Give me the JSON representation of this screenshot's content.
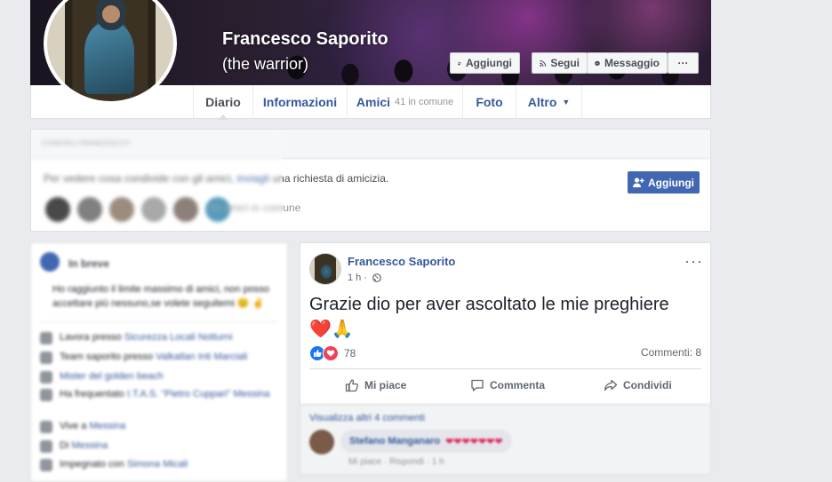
{
  "profile": {
    "name": "Francesco Saporito",
    "alias": "(the warrior)"
  },
  "cover_buttons": {
    "add_friend": "Aggiungi",
    "follow": "Segui",
    "message": "Messaggio",
    "more": "···"
  },
  "tabs": [
    {
      "label": "Diario"
    },
    {
      "label": "Informazioni"
    },
    {
      "label": "Amici",
      "sub": "41 in comune"
    },
    {
      "label": "Foto"
    },
    {
      "label": "Altro"
    }
  ],
  "know_box": {
    "heading": "CONOSCI FRANCESCO?",
    "text_before": "Per vedere cosa condivide con gli amici, ",
    "link": "inviagli",
    "text_after": " una richiesta di amicizia.",
    "mutual": "41 amici in comune",
    "add_button": "Aggiungi"
  },
  "intro": {
    "title": "In breve",
    "bio": "Ho raggiunto il limite massimo di amici, non posso accettare più nessuno,se volete seguitemi 😊 ✌",
    "rows": [
      {
        "prefix": "Lavora presso ",
        "link": "Sicurezza Locali Notturni"
      },
      {
        "prefix": "Team saporito presso ",
        "link": "Valkatlan Inti Marciali"
      },
      {
        "prefix": "",
        "link": "Mister del golden beach"
      },
      {
        "prefix": "Ha frequentato ",
        "link": "I.T.A.S. \"Pietro Cuppari\" Messina"
      },
      {
        "prefix": "Vive a ",
        "link": "Messina"
      },
      {
        "prefix": "Di ",
        "link": "Messina"
      },
      {
        "prefix": "Impegnato con ",
        "link": "Simona Micali"
      }
    ]
  },
  "post": {
    "author": "Francesco Saporito",
    "time": "1 h",
    "text_line1": "Grazie dio per aver ascoltato le mie preghiere",
    "emoji": "❤️🙏",
    "reaction_count": "78",
    "comments_count": "Commenti: 8",
    "like_label": "Mi piace",
    "comment_label": "Commenta",
    "share_label": "Condividi",
    "more": "···"
  },
  "comments": {
    "view_more": "Visualizza altri 4 commenti",
    "commenter": "Stefano Manganaro",
    "comment_text": "❤❤❤❤❤❤❤",
    "actions": "Mi piace · Rispondi · 1 h"
  },
  "colors": {
    "fb_blue": "#4267b2",
    "link_blue": "#365899",
    "background": "#e9ebee"
  }
}
